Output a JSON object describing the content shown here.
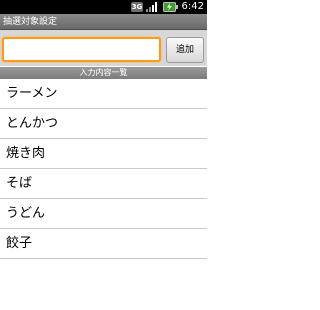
{
  "status_bar": {
    "network_label": "3G",
    "time": "6:42"
  },
  "title_bar": {
    "title": "抽選対象設定"
  },
  "input": {
    "value": "",
    "add_label": "追加"
  },
  "list_header": "入力内容一覧",
  "items": [
    {
      "label": "ラーメン"
    },
    {
      "label": "とんかつ"
    },
    {
      "label": "焼き肉"
    },
    {
      "label": "そば"
    },
    {
      "label": "うどん"
    },
    {
      "label": "餃子"
    }
  ],
  "icons": {
    "network": "3g-icon",
    "signal": "signal-icon",
    "battery": "battery-charging-icon"
  },
  "colors": {
    "focus_border": "#ff9a1a",
    "title_bar_bg": "#7a7a7a",
    "status_bar_bg": "#000000"
  }
}
